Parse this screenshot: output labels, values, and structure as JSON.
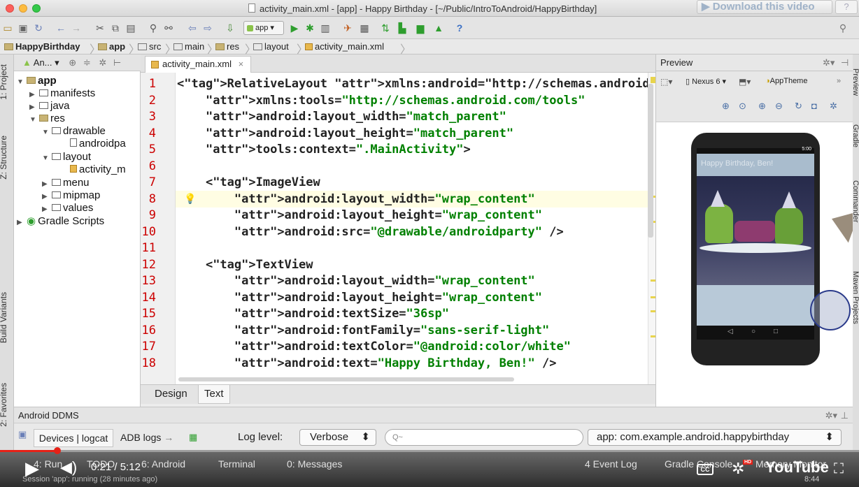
{
  "window": {
    "title": "activity_main.xml - [app] - Happy Birthday - [~/Public/IntroToAndroid/HappyBirthday]",
    "download_label": "Download this video",
    "help_label": "?"
  },
  "toolbar": {
    "app_combo": "app"
  },
  "breadcrumb": [
    "HappyBirthday",
    "app",
    "src",
    "main",
    "res",
    "layout",
    "activity_main.xml"
  ],
  "left_tabs": [
    "1: Project",
    "Z: Structure",
    "Build Variants",
    "2: Favorites"
  ],
  "project": {
    "header": "An...",
    "tree": [
      {
        "label": "app",
        "indent": 0,
        "expanded": true
      },
      {
        "label": "manifests",
        "indent": 1,
        "expanded": false
      },
      {
        "label": "java",
        "indent": 1,
        "expanded": false
      },
      {
        "label": "res",
        "indent": 1,
        "expanded": true
      },
      {
        "label": "drawable",
        "indent": 2,
        "expanded": true
      },
      {
        "label": "androidpa",
        "indent": 3,
        "expanded": null
      },
      {
        "label": "layout",
        "indent": 2,
        "expanded": true
      },
      {
        "label": "activity_m",
        "indent": 3,
        "expanded": null
      },
      {
        "label": "menu",
        "indent": 2,
        "expanded": false
      },
      {
        "label": "mipmap",
        "indent": 2,
        "expanded": false
      },
      {
        "label": "values",
        "indent": 2,
        "expanded": false
      },
      {
        "label": "Gradle Scripts",
        "indent": 0,
        "expanded": false
      }
    ]
  },
  "editor": {
    "tab_label": "activity_main.xml",
    "tab_close": "×",
    "bottom_tabs": [
      "Design",
      "Text"
    ],
    "lines": [
      {
        "n": "1",
        "text": "<RelativeLayout xmlns:android=\"http://schemas.android.cor"
      },
      {
        "n": "2",
        "text": "    xmlns:tools=\"http://schemas.android.com/tools\""
      },
      {
        "n": "3",
        "text": "    android:layout_width=\"match_parent\""
      },
      {
        "n": "4",
        "text": "    android:layout_height=\"match_parent\""
      },
      {
        "n": "5",
        "text": "    tools:context=\".MainActivity\">"
      },
      {
        "n": "6",
        "text": ""
      },
      {
        "n": "7",
        "text": "    <ImageView"
      },
      {
        "n": "8",
        "text": "        android:layout_width=\"wrap_content\""
      },
      {
        "n": "9",
        "text": "        android:layout_height=\"wrap_content\""
      },
      {
        "n": "10",
        "text": "        android:src=\"@drawable/androidparty\" />"
      },
      {
        "n": "11",
        "text": ""
      },
      {
        "n": "12",
        "text": "    <TextView"
      },
      {
        "n": "13",
        "text": "        android:layout_width=\"wrap_content\""
      },
      {
        "n": "14",
        "text": "        android:layout_height=\"wrap_content\""
      },
      {
        "n": "15",
        "text": "        android:textSize=\"36sp\""
      },
      {
        "n": "16",
        "text": "        android:fontFamily=\"sans-serif-light\""
      },
      {
        "n": "17",
        "text": "        android:textColor=\"@android:color/white\""
      },
      {
        "n": "18",
        "text": "        android:text=\"Happy Birthday, Ben!\" />"
      }
    ]
  },
  "preview": {
    "title": "Preview",
    "device": "Nexus 6",
    "theme": "AppTheme",
    "phone_status_time": "5:00",
    "phone_greeting": "Happy Birthday, Ben!"
  },
  "right_tabs": [
    "Preview",
    "Gradle",
    "Commander",
    "Maven Projects"
  ],
  "ddms": {
    "title": "Android DDMS",
    "tab_devices": "Devices | logcat",
    "tab_adb": "ADB logs",
    "log_level_label": "Log level:",
    "log_level_value": "Verbose",
    "search_placeholder": "Q~",
    "app_value": "app: com.example.android.happybirthday"
  },
  "statusbar": {
    "items": [
      "4: Run",
      "TODO",
      "6: Android",
      "Terminal",
      "0: Messages",
      "4 Event Log",
      "Gradle Console",
      "Memory Monitor"
    ],
    "session": "Session 'app': running (28 minutes ago)",
    "clock": "8:44"
  },
  "video": {
    "time_current": "0:21",
    "time_total": "5:12",
    "progress": 0.067,
    "logo": "YouTube"
  },
  "colors": {
    "line_numbers": "#cc0000",
    "tag": "#000080",
    "attribute": "#660e7a",
    "value": "#008000",
    "progress": "#e62117"
  }
}
